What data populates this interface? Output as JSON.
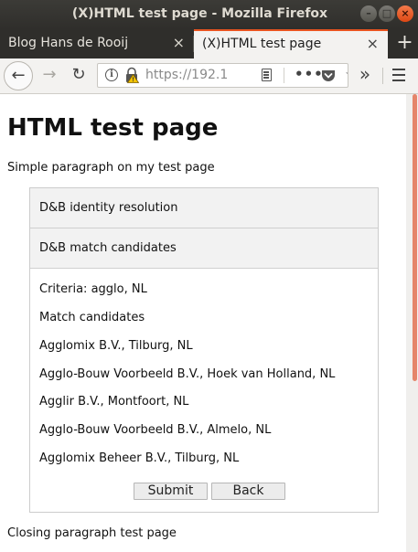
{
  "window": {
    "title": "(X)HTML test page - Mozilla Firefox",
    "minimize_glyph": "–",
    "maximize_glyph": "□",
    "close_glyph": "×"
  },
  "tabs": [
    {
      "label": "Blog Hans de Rooij",
      "close_glyph": "×",
      "active": false
    },
    {
      "label": "(X)HTML test page",
      "close_glyph": "×",
      "active": true
    }
  ],
  "new_tab_glyph": "+",
  "navbar": {
    "back_glyph": "←",
    "forward_glyph": "→",
    "reload_glyph": "↻",
    "url": "https://192.1",
    "page_actions_glyph": "•••",
    "star_glyph": "☆",
    "overflow_glyph": "»",
    "icons": [
      "info-icon",
      "lock-warning-icon",
      "reader-view-icon",
      "page-actions-icon",
      "pocket-icon",
      "bookmark-star-icon",
      "overflow-icon",
      "hamburger-menu-icon"
    ]
  },
  "page": {
    "title": "HTML test page",
    "intro": "Simple paragraph on my test page",
    "panel": {
      "header1": "D&B identity resolution",
      "header2": "D&B match candidates",
      "criteria": "Criteria: agglo, NL",
      "candidates_label": "Match candidates",
      "candidates": [
        "Agglomix B.V., Tilburg, NL",
        "Agglo-Bouw Voorbeeld B.V., Hoek van Holland, NL",
        "Agglir B.V., Montfoort, NL",
        "Agglo-Bouw Voorbeeld B.V., Almelo, NL",
        "Agglomix Beheer B.V., Tilburg, NL"
      ],
      "submit_label": "Submit",
      "back_label": "Back"
    },
    "closing": "Closing paragraph test page"
  },
  "colors": {
    "titlebar": "#3c3b37",
    "accent": "#e95420",
    "scrollbar_thumb": "#e5856a",
    "panel_header_bg": "#f2f2f2"
  }
}
